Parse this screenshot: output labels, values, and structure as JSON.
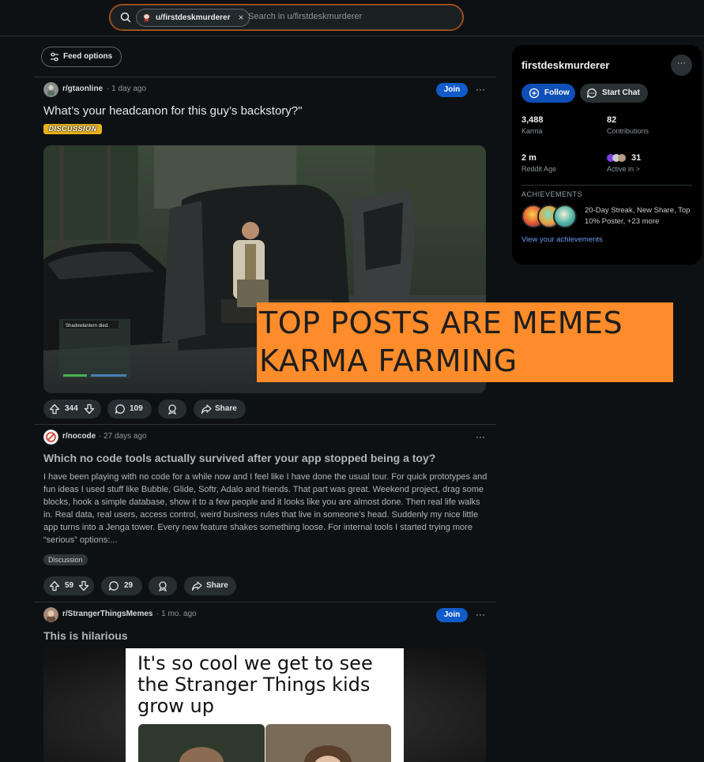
{
  "search": {
    "scope_chip": "u/firstdeskmurderer",
    "placeholder": "Search in u/firstdeskmurderer"
  },
  "feed_options_label": "Feed options",
  "posts": [
    {
      "subreddit": "r/gtaonline",
      "age": "1 day ago",
      "join_label": "Join",
      "title": "What’s your headcanon for this guy’s backstory?\"",
      "flair": "DISCUSSION",
      "game_hud_text": "Shadowlantern died.",
      "upvotes": "344",
      "comments": "109",
      "share_label": "Share"
    },
    {
      "subreddit": "r/nocode",
      "age": "27 days ago",
      "title": "Which no code tools actually survived after your app stopped being a toy?",
      "body": "I have been playing with no code for a while now and I feel like I have done the usual tour. For quick prototypes and fun ideas I used stuff like Bubble, Glide, Softr, Adalo and friends. That part was great. Weekend project, drag some blocks, hook a simple database, show it to a few people and it looks like you are almost done. Then real life walks in. Real data, real users, access control, weird business rules that live in someone’s head. Suddenly my nice little app turns into a Jenga tower. Every new feature shakes something loose. For internal tools I started trying more “serious” options:...",
      "flair": "Discussion",
      "upvotes": "59",
      "comments": "29",
      "share_label": "Share"
    },
    {
      "subreddit": "r/StrangerThingsMemes",
      "age": "1 mo. ago",
      "join_label": "Join",
      "title": "This is hilarious",
      "meme_text": "It's so cool we get to see the Stranger Things kids grow up"
    }
  ],
  "overlay": {
    "line1": "TOP POSTS ARE MEMES",
    "line2": "KARMA FARMING",
    "color": "#ff8c2a"
  },
  "sidebar": {
    "username": "firstdeskmurderer",
    "follow_label": "Follow",
    "chat_label": "Start Chat",
    "karma_value": "3,488",
    "karma_label": "Karma",
    "contrib_value": "82",
    "contrib_label": "Contributions",
    "age_value": "2 m",
    "age_label": "Reddit Age",
    "active_value": "31",
    "active_label": "Active in >",
    "achievements_heading": "ACHIEVEMENTS",
    "achievements_text": "20-Day Streak, New Share, Top 10% Poster, +23 more",
    "achievements_link": "View your achievements"
  },
  "colors": {
    "accent_blue": "#115bca",
    "background": "#0e1113",
    "flair_gold": "#e8b21b",
    "search_border": "#d2531e"
  }
}
